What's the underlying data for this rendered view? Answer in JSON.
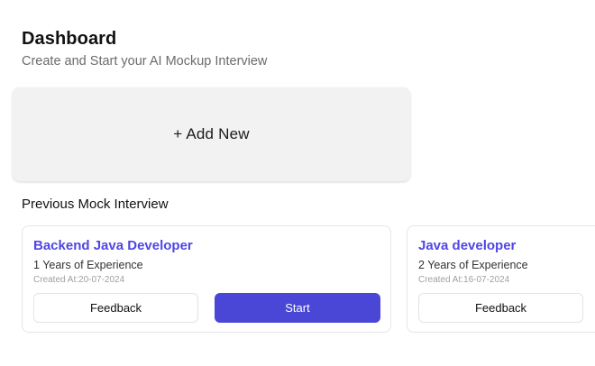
{
  "header": {
    "title": "Dashboard",
    "subtitle": "Create and Start your AI Mockup Interview"
  },
  "add_new": {
    "label": "+ Add New"
  },
  "previous": {
    "section_title": "Previous Mock Interview",
    "interviews": [
      {
        "job_role": "Backend Java Developer",
        "experience": "1 Years of Experience",
        "created_at": "Created At:20-07-2024",
        "feedback_label": "Feedback",
        "start_label": "Start"
      },
      {
        "job_role": "Java developer",
        "experience": "2 Years of Experience",
        "created_at": "Created At:16-07-2024",
        "feedback_label": "Feedback"
      }
    ]
  },
  "colors": {
    "accent": "#4f46e5",
    "start_button": "#4a46d6",
    "add_new_background": "#f2f2f2"
  }
}
